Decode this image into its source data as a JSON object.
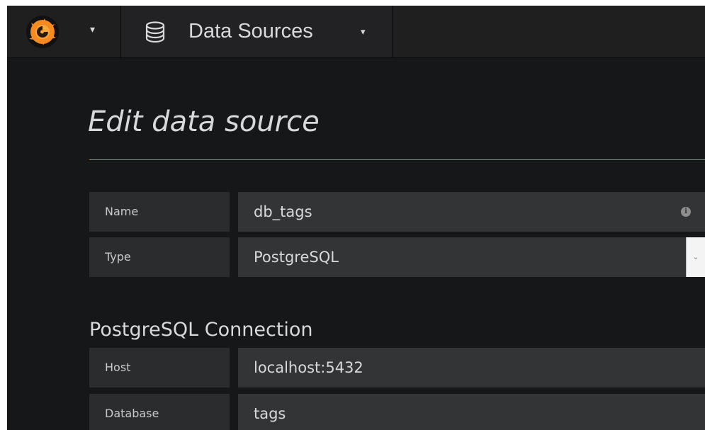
{
  "navbar": {
    "logo_caret": "▾",
    "menu_label": "Data Sources",
    "menu_caret": "▾",
    "icons": {
      "logo": "grafana-logo-icon",
      "menu": "database-icon"
    }
  },
  "page": {
    "title": "Edit data source"
  },
  "form": {
    "name": {
      "label": "Name",
      "value": "db_tags"
    },
    "type": {
      "label": "Type",
      "value": "PostgreSQL"
    }
  },
  "connection": {
    "heading": "PostgreSQL Connection",
    "host": {
      "label": "Host",
      "value": "localhost:5432"
    },
    "database": {
      "label": "Database",
      "value": "tags"
    }
  },
  "colors": {
    "background": "#161719",
    "accent_rule": "#b08428",
    "logo_orange": "#f58a21"
  }
}
